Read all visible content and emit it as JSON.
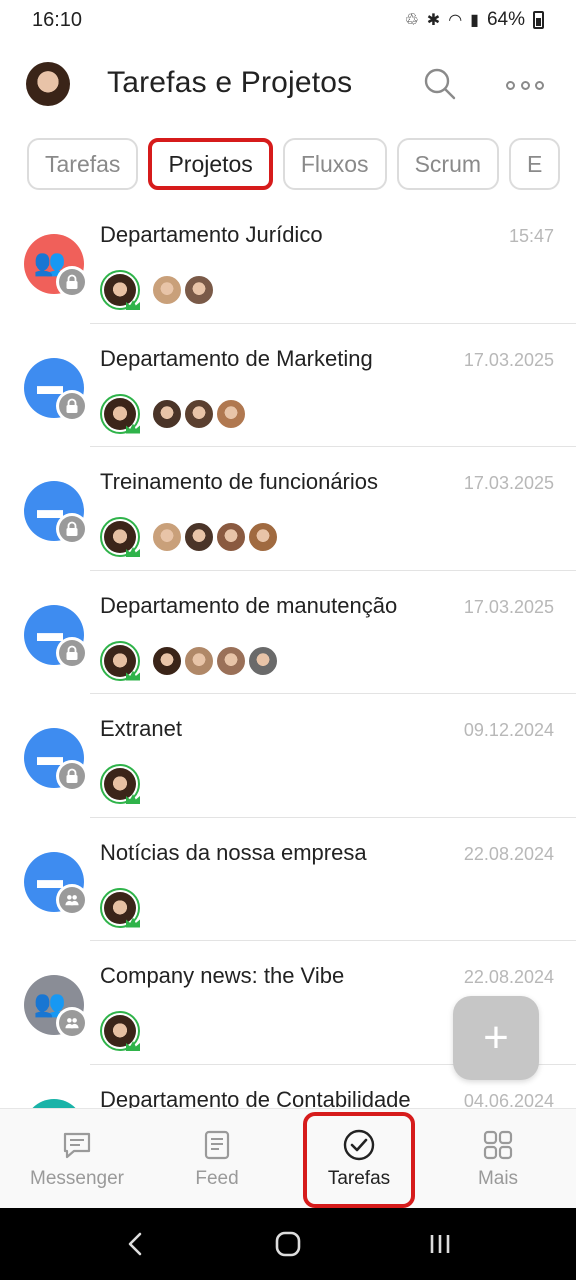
{
  "status": {
    "time": "16:10",
    "battery": "64%"
  },
  "header": {
    "title": "Tarefas e Projetos"
  },
  "tabs": [
    {
      "label": "Tarefas",
      "active": false
    },
    {
      "label": "Projetos",
      "active": true
    },
    {
      "label": "Fluxos",
      "active": false
    },
    {
      "label": "Scrum",
      "active": false
    },
    {
      "label": "E",
      "active": false
    }
  ],
  "projects": [
    {
      "title": "Departamento Jurídico",
      "date": "15:47",
      "icon": "group-icon",
      "color": "#f0605a",
      "badge": "lock-icon",
      "members": [
        "#c9a07a",
        "#7a5a48"
      ]
    },
    {
      "title": "Departamento de Marketing",
      "date": "17.03.2025",
      "icon": "folder-icon",
      "color": "#3e8cf0",
      "badge": "lock-icon",
      "members": [
        "#4a3428",
        "#5b4030",
        "#b07850"
      ]
    },
    {
      "title": "Treinamento de funcionários",
      "date": "17.03.2025",
      "icon": "folder-icon",
      "color": "#3e8cf0",
      "badge": "lock-icon",
      "members": [
        "#c9a07a",
        "#4a3428",
        "#8a5a40",
        "#a06a40"
      ]
    },
    {
      "title": "Departamento de manutenção",
      "date": "17.03.2025",
      "icon": "folder-icon",
      "color": "#3e8cf0",
      "badge": "lock-icon",
      "members": [
        "#3a2418",
        "#b08868",
        "#9a7058",
        "#6a6a6a"
      ]
    },
    {
      "title": "Extranet",
      "date": "09.12.2024",
      "icon": "folder-icon",
      "color": "#3e8cf0",
      "badge": "lock-icon",
      "members": []
    },
    {
      "title": "Notícias da nossa empresa",
      "date": "22.08.2024",
      "icon": "folder-icon",
      "color": "#3e8cf0",
      "badge": "group-badge-icon",
      "members": []
    },
    {
      "title": "Company news: the Vibe",
      "date": "22.08.2024",
      "icon": "group-icon",
      "color": "#8a8d96",
      "badge": "group-badge-icon",
      "members": []
    },
    {
      "title": "Departamento de Contabilidade",
      "date": "04.06.2024",
      "icon": "folder-icon",
      "color": "#1ab3a8",
      "badge": "lock-icon",
      "members": []
    }
  ],
  "fab": {
    "glyph": "+"
  },
  "bottom_nav": [
    {
      "label": "Messenger",
      "icon": "chat-icon"
    },
    {
      "label": "Feed",
      "icon": "feed-icon"
    },
    {
      "label": "Tarefas",
      "icon": "check-circle-icon"
    },
    {
      "label": "Mais",
      "icon": "grid-icon"
    }
  ]
}
